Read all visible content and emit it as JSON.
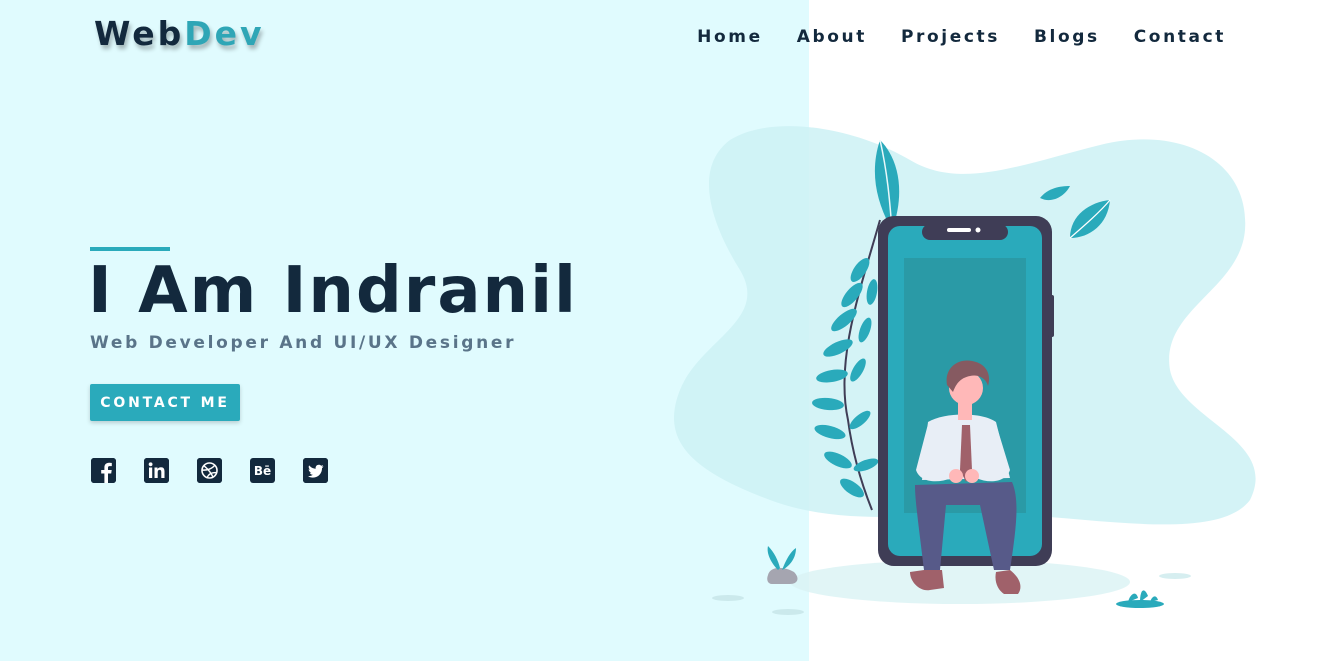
{
  "brand": {
    "logo_part1": "Web",
    "logo_part2": "Dev",
    "accent_color": "#2fa6b6",
    "dark_color": "#13293d",
    "left_bg_color": "#e0fbfe"
  },
  "nav": {
    "items": [
      {
        "label": "Home"
      },
      {
        "label": "About"
      },
      {
        "label": "Projects"
      },
      {
        "label": "Blogs"
      },
      {
        "label": "Contact"
      }
    ]
  },
  "hero": {
    "title": "I Am Indranil",
    "subtitle": "Web Developer And UI/UX Designer",
    "cta_label": "CONTACT ME"
  },
  "social": {
    "icons": [
      "facebook-icon",
      "linkedin-icon",
      "dribbble-icon",
      "behance-icon",
      "twitter-icon"
    ],
    "behance_text": "Bē"
  },
  "illustration": {
    "subject": "man-sitting-in-phone-illustration"
  }
}
